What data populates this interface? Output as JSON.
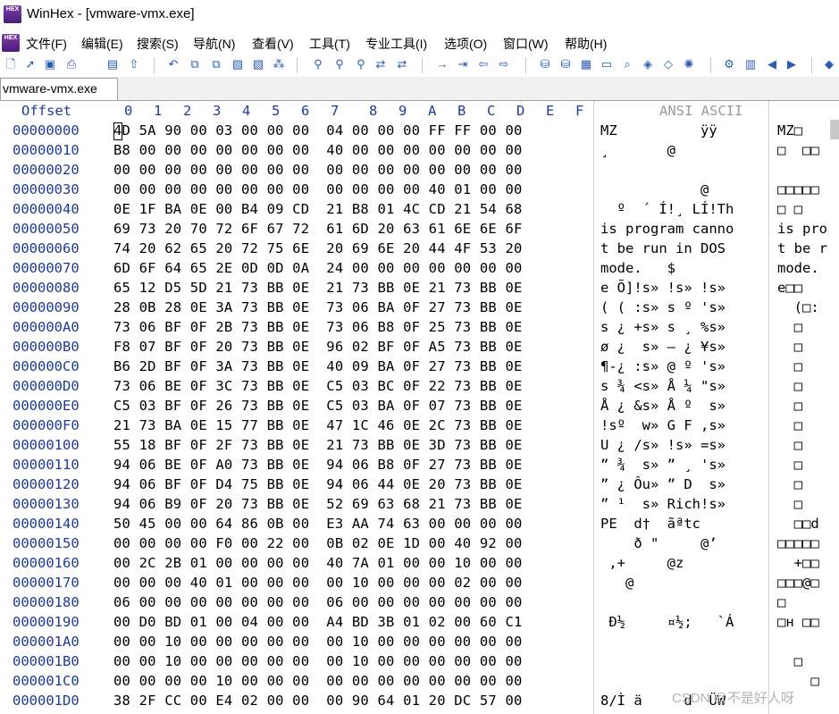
{
  "window": {
    "title": "WinHex - [vmware-vmx.exe]",
    "app_icon_text": "HEX"
  },
  "menu": [
    "文件(F)",
    "编辑(E)",
    "搜索(S)",
    "导航(N)",
    "查看(V)",
    "工具(T)",
    "专业工具(I)",
    "选项(O)",
    "窗口(W)",
    "帮助(H)"
  ],
  "toolbar_icons": [
    "new-icon",
    "open-icon",
    "save-icon",
    "print-icon",
    "properties-icon",
    "undo-icon",
    "copy-icon",
    "paste-icon",
    "find-icon",
    "replace-icon",
    "find-hex-icon",
    "go-to-icon",
    "back-icon",
    "forward-icon",
    "disk-icon",
    "ram-icon",
    "calculator-icon",
    "hash-icon"
  ],
  "tab": {
    "label": "vmware-vmx.exe"
  },
  "header": {
    "offset": "Offset",
    "columns": [
      "0",
      "1",
      "2",
      "3",
      "4",
      "5",
      "6",
      "7",
      "8",
      "9",
      "A",
      "B",
      "C",
      "D",
      "E",
      "F"
    ],
    "ansi": "ANSI ASCII"
  },
  "rows": [
    {
      "off": "00000000",
      "hex": "4D 5A 90 00 03 00 00 00  04 00 00 00 FF FF 00 00",
      "ansi": "MZ          ÿÿ  ",
      "ascii": "MZ□"
    },
    {
      "off": "00000010",
      "hex": "B8 00 00 00 00 00 00 00  40 00 00 00 00 00 00 00",
      "ansi": "¸       @       ",
      "ascii": "□  □□"
    },
    {
      "off": "00000020",
      "hex": "00 00 00 00 00 00 00 00  00 00 00 00 00 00 00 00",
      "ansi": "",
      "ascii": ""
    },
    {
      "off": "00000030",
      "hex": "00 00 00 00 00 00 00 00  00 00 00 00 40 01 00 00",
      "ansi": "            @   ",
      "ascii": "□□□□□"
    },
    {
      "off": "00000040",
      "hex": "0E 1F BA 0E 00 B4 09 CD  21 B8 01 4C CD 21 54 68",
      "ansi": "  º  ´ Í!¸ LÍ!Th",
      "ascii": "□ □"
    },
    {
      "off": "00000050",
      "hex": "69 73 20 70 72 6F 67 72  61 6D 20 63 61 6E 6E 6F",
      "ansi": "is program canno",
      "ascii": "is pro"
    },
    {
      "off": "00000060",
      "hex": "74 20 62 65 20 72 75 6E  20 69 6E 20 44 4F 53 20",
      "ansi": "t be run in DOS ",
      "ascii": "t be r"
    },
    {
      "off": "00000070",
      "hex": "6D 6F 64 65 2E 0D 0D 0A  24 00 00 00 00 00 00 00",
      "ansi": "mode.   $       ",
      "ascii": "mode."
    },
    {
      "off": "00000080",
      "hex": "65 12 D5 5D 21 73 BB 0E  21 73 BB 0E 21 73 BB 0E",
      "ansi": "e Õ]!s» !s» !s» ",
      "ascii": "e□□"
    },
    {
      "off": "00000090",
      "hex": "28 0B 28 0E 3A 73 BB 0E  73 06 BA 0F 27 73 BB 0E",
      "ansi": "( ( :s» s º 's» ",
      "ascii": "  (□:"
    },
    {
      "off": "000000A0",
      "hex": "73 06 BF 0F 2B 73 BB 0E  73 06 B8 0F 25 73 BB 0E",
      "ansi": "s ¿ +s» s ¸ %s» ",
      "ascii": "  □"
    },
    {
      "off": "000000B0",
      "hex": "F8 07 BF 0F 20 73 BB 0E  96 02 BF 0F A5 73 BB 0E",
      "ansi": "ø ¿  s» – ¿ ¥s» ",
      "ascii": "  □"
    },
    {
      "off": "000000C0",
      "hex": "B6 2D BF 0F 3A 73 BB 0E  40 09 BA 0F 27 73 BB 0E",
      "ansi": "¶-¿ :s» @ º 's» ",
      "ascii": "  □"
    },
    {
      "off": "000000D0",
      "hex": "73 06 BE 0F 3C 73 BB 0E  C5 03 BC 0F 22 73 BB 0E",
      "ansi": "s ¾ <s» Å ¼ \"s» ",
      "ascii": "  □"
    },
    {
      "off": "000000E0",
      "hex": "C5 03 BF 0F 26 73 BB 0E  C5 03 BA 0F 07 73 BB 0E",
      "ansi": "Å ¿ &s» Å º  s» ",
      "ascii": "  □"
    },
    {
      "off": "000000F0",
      "hex": "21 73 BA 0E 15 77 BB 0E  47 1C 46 0E 2C 73 BB 0E",
      "ansi": "!sº  w» G F ,s» ",
      "ascii": "  □"
    },
    {
      "off": "00000100",
      "hex": "55 18 BF 0F 2F 73 BB 0E  21 73 BB 0E 3D 73 BB 0E",
      "ansi": "U ¿ /s» !s» =s» ",
      "ascii": "  □"
    },
    {
      "off": "00000110",
      "hex": "94 06 BE 0F A0 73 BB 0E  94 06 B8 0F 27 73 BB 0E",
      "ansi": "” ¾  s» ” ¸ 's» ",
      "ascii": "  □"
    },
    {
      "off": "00000120",
      "hex": "94 06 BF 0F D4 75 BB 0E  94 06 44 0E 20 73 BB 0E",
      "ansi": "” ¿ Ôu» ” D  s» ",
      "ascii": "  □"
    },
    {
      "off": "00000130",
      "hex": "94 06 B9 0F 20 73 BB 0E  52 69 63 68 21 73 BB 0E",
      "ansi": "” ¹  s» Rich!s» ",
      "ascii": "  □"
    },
    {
      "off": "00000140",
      "hex": "50 45 00 00 64 86 0B 00  E3 AA 74 63 00 00 00 00",
      "ansi": "PE  d†  ãªtc    ",
      "ascii": "  □□d"
    },
    {
      "off": "00000150",
      "hex": "00 00 00 00 F0 00 22 00  0B 02 0E 1D 00 40 92 00",
      "ansi": "    ð \"     @’ ",
      "ascii": "□□□□□"
    },
    {
      "off": "00000160",
      "hex": "00 2C 2B 01 00 00 00 00  40 7A 01 00 00 10 00 00",
      "ansi": " ,+     @z      ",
      "ascii": "  +□□"
    },
    {
      "off": "00000170",
      "hex": "00 00 00 40 01 00 00 00  00 10 00 00 00 02 00 00",
      "ansi": "   @            ",
      "ascii": "□□□@□"
    },
    {
      "off": "00000180",
      "hex": "06 00 00 00 00 00 00 00  06 00 00 00 00 00 00 00",
      "ansi": "",
      "ascii": "□"
    },
    {
      "off": "00000190",
      "hex": "00 D0 BD 01 00 04 00 00  A4 BD 3B 01 02 00 60 C1",
      "ansi": " Ð½     ¤½;   `Á",
      "ascii": "□н □□"
    },
    {
      "off": "000001A0",
      "hex": "00 00 10 00 00 00 00 00  00 10 00 00 00 00 00 00",
      "ansi": "",
      "ascii": ""
    },
    {
      "off": "000001B0",
      "hex": "00 00 10 00 00 00 00 00  00 10 00 00 00 00 00 00",
      "ansi": "",
      "ascii": "  □"
    },
    {
      "off": "000001C0",
      "hex": "00 00 00 00 10 00 00 00  00 00 00 00 00 00 00 00",
      "ansi": "",
      "ascii": "    □"
    },
    {
      "off": "000001D0",
      "hex": "38 2F CC 00 E4 02 00 00  00 90 64 01 20 DC 57 00",
      "ansi": "8/Ì ä     d  ÜW ",
      "ascii": ""
    }
  ],
  "watermark": "CSDN @不是好人呀"
}
